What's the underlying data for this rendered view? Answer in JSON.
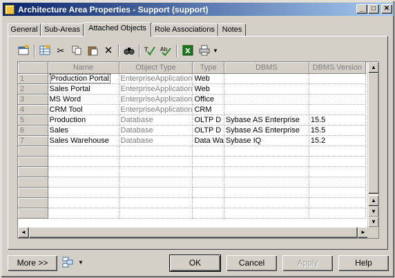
{
  "window": {
    "title": "Architecture Area Properties - Support (support)"
  },
  "tabs": [
    "General",
    "Sub-Areas",
    "Attached Objects",
    "Role Associations",
    "Notes"
  ],
  "active_tab": "Attached Objects",
  "toolbar": {
    "icons": [
      "properties-icon",
      "add-objects-icon",
      "cut-icon",
      "copy-icon",
      "paste-icon",
      "delete-icon",
      "find-icon",
      "filter-icon",
      "customize-columns-icon",
      "excel-export-icon",
      "print-icon",
      "dropdown-arrow-icon"
    ]
  },
  "grid": {
    "columns": [
      "Name",
      "Object Type",
      "Type",
      "DBMS",
      "DBMS Version"
    ],
    "rows": [
      {
        "num": "1",
        "name": "Production Portal",
        "object_type": "EnterpriseApplication",
        "type": "Web",
        "dbms": "",
        "version": ""
      },
      {
        "num": "2",
        "name": "Sales Portal",
        "object_type": "EnterpriseApplication",
        "type": "Web",
        "dbms": "",
        "version": ""
      },
      {
        "num": "3",
        "name": "MS Word",
        "object_type": "EnterpriseApplication",
        "type": "Office",
        "dbms": "",
        "version": ""
      },
      {
        "num": "4",
        "name": "CRM Tool",
        "object_type": "EnterpriseApplication",
        "type": "CRM",
        "dbms": "",
        "version": ""
      },
      {
        "num": "5",
        "name": "Production",
        "object_type": "Database",
        "type": "OLTP D",
        "dbms": "Sybase AS Enterprise",
        "version": "15.5"
      },
      {
        "num": "6",
        "name": "Sales",
        "object_type": "Database",
        "type": "OLTP D",
        "dbms": "Sybase AS Enterprise",
        "version": "15.5"
      },
      {
        "num": "7",
        "name": "Sales Warehouse",
        "object_type": "Database",
        "type": "Data Wa",
        "dbms": "Sybase IQ",
        "version": "15.2"
      }
    ]
  },
  "buttons": {
    "more": "More >>",
    "ok": "OK",
    "cancel": "Cancel",
    "apply": "Apply",
    "help": "Help"
  }
}
